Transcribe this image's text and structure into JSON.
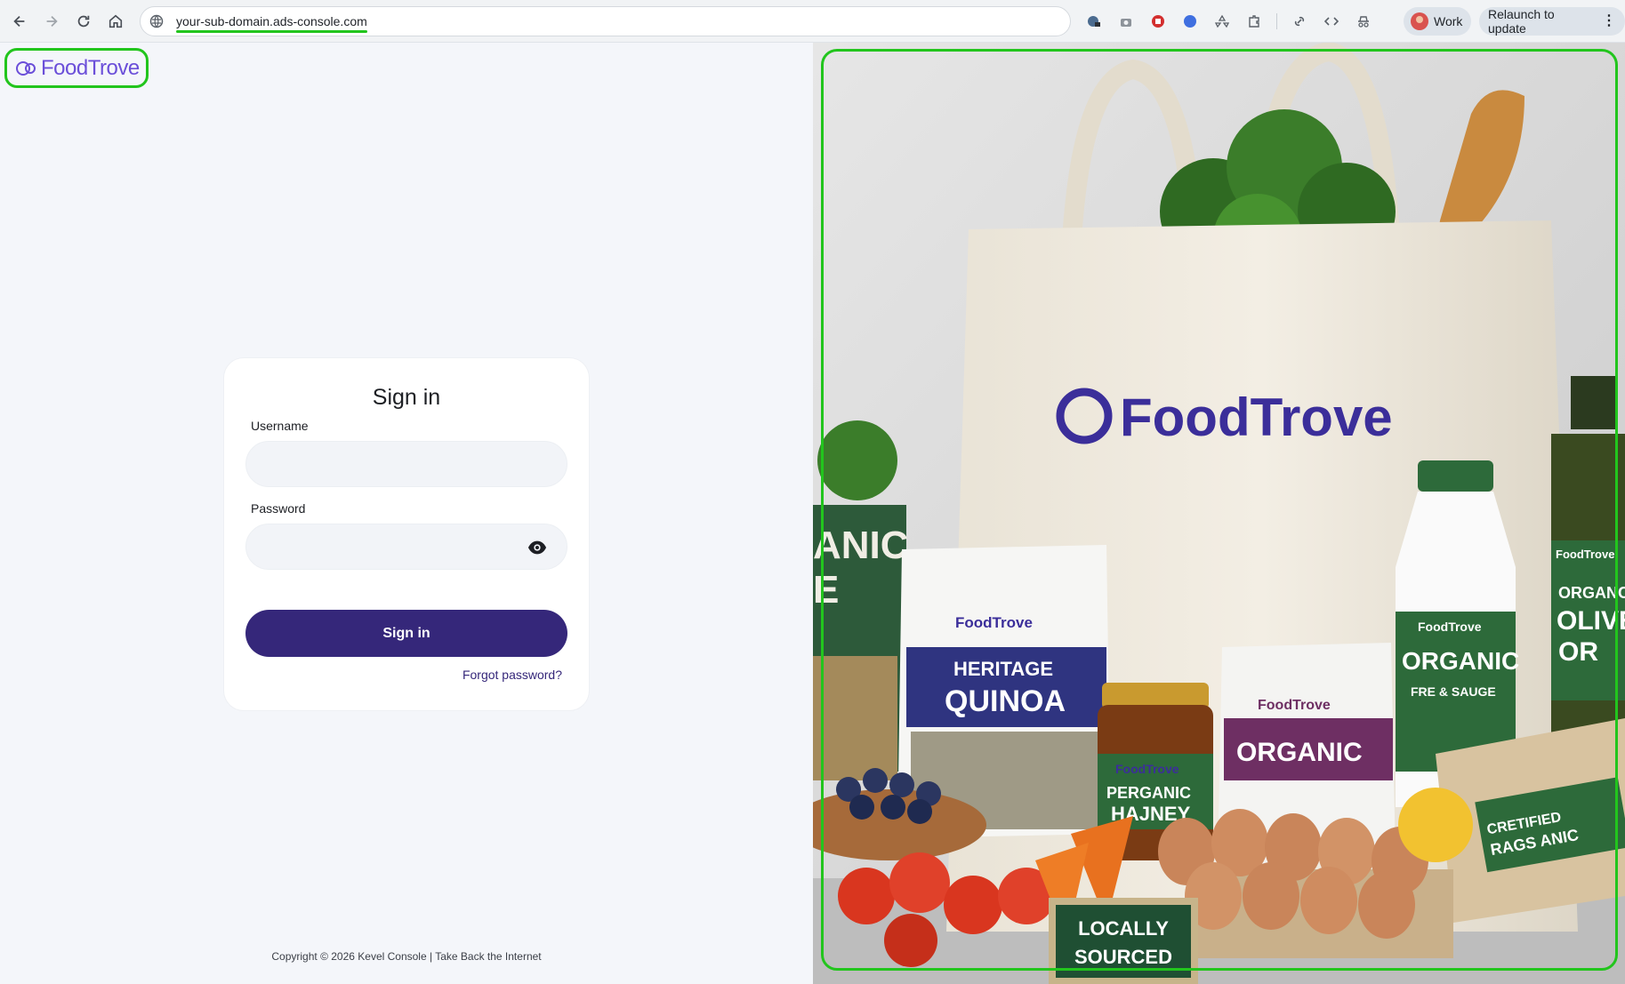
{
  "browser": {
    "url": "your-sub-domain.ads-console.com",
    "profile_label": "Work",
    "relaunch_label": "Relaunch to update",
    "nav": [
      "back-icon",
      "forward-icon",
      "reload-icon",
      "home-icon"
    ],
    "extensions": [
      "info-lock-icon",
      "camera-icon",
      "record-icon",
      "circle-icon",
      "recycle-icon",
      "puzzle-icon",
      "link-icon",
      "code-icon",
      "incognito-icon"
    ]
  },
  "brand": {
    "logo_text": "FoodTrove",
    "accent": "#6b4fd9",
    "button_color": "#35277a"
  },
  "signin": {
    "title": "Sign in",
    "username_label": "Username",
    "username_value": "",
    "password_label": "Password",
    "password_value": "",
    "button_label": "Sign in",
    "forgot_label": "Forgot password?"
  },
  "footer": {
    "copyright": "Copyright © 2026 Kevel Console | Take Back the Internet"
  },
  "hero": {
    "bag_brand": "FoodTrove",
    "pouch_brand": "FoodTrove",
    "quinoa_line1": "HERITAGE",
    "quinoa_line2": "QUINOA",
    "honey_line1": "PERGANIC",
    "honey_line2": "HAJNEY",
    "organic_pouch": "ORGANIC",
    "milk_line1": "ORGANIC",
    "milk_line2": "FRE & SAUGE",
    "oil_line1": "ORGANC",
    "oil_line2": "OLIVE",
    "oil_line3": "OR",
    "eggs_line1": "CRETIFIED",
    "eggs_line2": "RAGS ANIC",
    "sign_line1": "LOCALLY",
    "sign_line2": "SOURCED",
    "left_bag_line1": "ANIC",
    "left_bag_line2": "E"
  }
}
